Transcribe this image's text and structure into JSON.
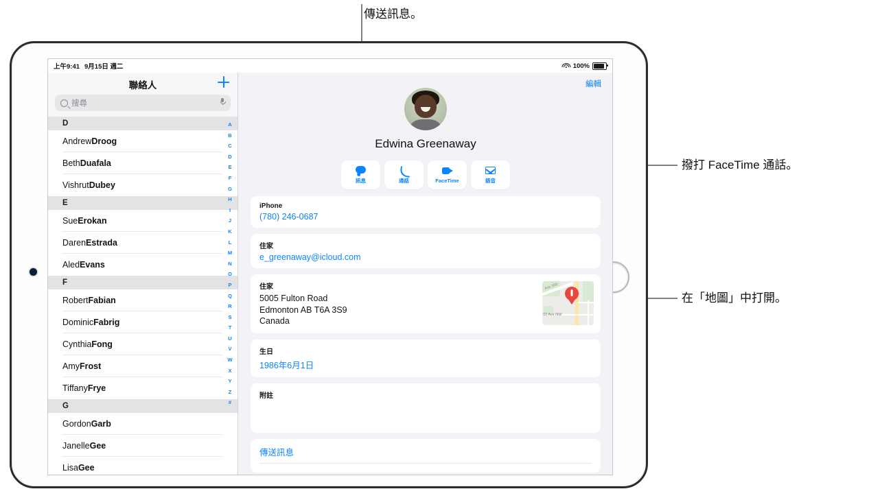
{
  "device": {
    "name": "iPad"
  },
  "statusbar": {
    "time": "上午9:41",
    "date": "9月15日 週二",
    "battery_pct": "100%",
    "wifi_icon": "wifi-icon",
    "battery_icon": "battery-icon"
  },
  "sidebar": {
    "title": "聯絡人",
    "add_icon": "plus-icon",
    "search": {
      "placeholder": "搜尋",
      "search_icon": "search-icon",
      "mic_icon": "microphone-icon"
    },
    "sections": [
      {
        "letter": "D",
        "contacts": [
          {
            "first": "Andrew ",
            "last": "Droog"
          },
          {
            "first": "Beth ",
            "last": "Duafala"
          },
          {
            "first": "Vishrut ",
            "last": "Dubey"
          }
        ]
      },
      {
        "letter": "E",
        "contacts": [
          {
            "first": "Sue ",
            "last": "Erokan"
          },
          {
            "first": "Daren ",
            "last": "Estrada"
          },
          {
            "first": "Aled ",
            "last": "Evans"
          }
        ]
      },
      {
        "letter": "F",
        "contacts": [
          {
            "first": "Robert ",
            "last": "Fabian"
          },
          {
            "first": "Dominic ",
            "last": "Fabrig"
          },
          {
            "first": "Cynthia ",
            "last": "Fong"
          },
          {
            "first": "Amy ",
            "last": "Frost"
          },
          {
            "first": "Tiffany ",
            "last": "Frye"
          }
        ]
      },
      {
        "letter": "G",
        "contacts": [
          {
            "first": "Gordon ",
            "last": "Garb"
          },
          {
            "first": "Janelle ",
            "last": "Gee"
          },
          {
            "first": "Lisa ",
            "last": "Gee"
          }
        ]
      }
    ],
    "index": [
      "A",
      "B",
      "C",
      "D",
      "E",
      "F",
      "G",
      "H",
      "I",
      "J",
      "K",
      "L",
      "M",
      "N",
      "O",
      "P",
      "Q",
      "R",
      "S",
      "T",
      "U",
      "V",
      "W",
      "X",
      "Y",
      "Z",
      "#"
    ]
  },
  "detail": {
    "edit_label": "編輯",
    "avatar_icon": "contact-photo",
    "contact_name": "Edwina Greenaway",
    "actions": [
      {
        "label": "訊息",
        "icon": "message-icon"
      },
      {
        "label": "通話",
        "icon": "phone-icon"
      },
      {
        "label": "FaceTime",
        "icon": "video-camera-icon"
      },
      {
        "label": "語音",
        "icon": "mail-icon"
      }
    ],
    "fields": {
      "phone": {
        "label": "iPhone",
        "value": "(780) 246-0687"
      },
      "email": {
        "label": "住家",
        "value": "e_greenaway@icloud.com"
      },
      "address": {
        "label": "住家",
        "line1": "5005 Fulton Road",
        "line2": "Edmonton AB T6A 3S9",
        "line3": "Canada",
        "map_icon": "map-thumbnail",
        "map_pin_icon": "map-pin-icon",
        "map_label_1": "Ave NW",
        "map_label_2": "03 Ave NW"
      },
      "birthday": {
        "label": "生日",
        "value": "1986年6月1日"
      },
      "notes": {
        "label": "附註",
        "value": ""
      },
      "send_message": {
        "label": "傳送訊息"
      }
    }
  },
  "callouts": {
    "top": "傳送訊息。",
    "facetime": "撥打 FaceTime 通話。",
    "map": "在「地圖」中打開。"
  },
  "colors": {
    "accent": "#0a84ff",
    "screen_bg": "#f2f2f7",
    "pin_red": "#e8453c",
    "leader_gray": "#808080"
  }
}
